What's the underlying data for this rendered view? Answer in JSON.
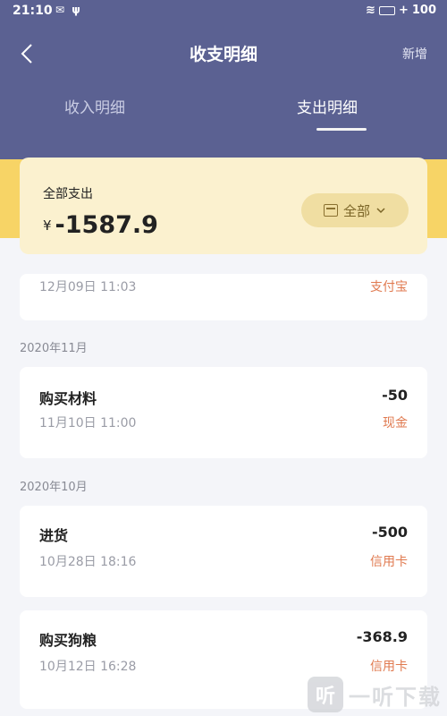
{
  "status_bar": {
    "time": "21:10",
    "battery": "100"
  },
  "header": {
    "title": "收支明细",
    "add_label": "新增"
  },
  "tabs": [
    {
      "label": "收入明细",
      "active": false
    },
    {
      "label": "支出明细",
      "active": true
    }
  ],
  "summary": {
    "label": "全部支出",
    "currency": "¥",
    "amount": "-1587.9",
    "filter_label": "全部"
  },
  "partial_item": {
    "time": "12月09日 11:03",
    "method": "支付宝"
  },
  "groups": [
    {
      "month": "2020年11月",
      "items": [
        {
          "title": "购买材料",
          "time": "11月10日 11:00",
          "amount": "-50",
          "method": "现金"
        }
      ]
    },
    {
      "month": "2020年10月",
      "items": [
        {
          "title": "进货",
          "time": "10月28日 18:16",
          "amount": "-500",
          "method": "信用卡"
        },
        {
          "title": "购买狗粮",
          "time": "10月12日 16:28",
          "amount": "-368.9",
          "method": "信用卡"
        }
      ]
    }
  ],
  "watermark": {
    "logo_glyph": "听",
    "text": "一听下载"
  },
  "colors": {
    "header": "#5b6192",
    "gold": "#f7d466",
    "summary_card": "#fbf1cf",
    "method": "#e07a50"
  }
}
